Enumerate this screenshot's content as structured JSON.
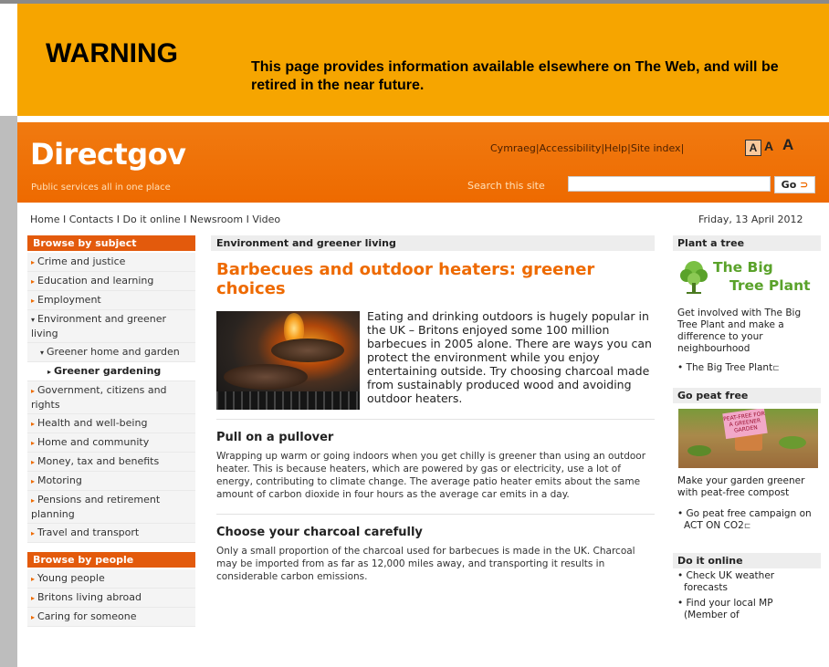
{
  "warning": {
    "title": "WARNING",
    "text": "This page provides information available elsewhere on The Web, and will be retired in the near future."
  },
  "header": {
    "logo": "Directgov",
    "tagline": "Public services all in one place",
    "util_links": [
      "Cymraeg",
      "Accessibility",
      "Help",
      "Site index"
    ],
    "text_size": [
      "A",
      "A",
      "A"
    ],
    "search_label": "Search this site",
    "search_value": "",
    "go_label": "Go"
  },
  "nav": {
    "items": [
      "Home",
      "Contacts",
      "Do it online",
      "Newsroom",
      "Video"
    ],
    "date": "Friday, 13 April 2012"
  },
  "left": {
    "subject_heading": "Browse by subject",
    "subject_items": [
      "Crime and justice",
      "Education and learning",
      "Employment",
      "Environment and greener living",
      "Greener home and garden",
      "Greener gardening",
      "Government, citizens and rights",
      "Health and well-being",
      "Home and community",
      "Money, tax and benefits",
      "Motoring",
      "Pensions and retirement planning",
      "Travel and transport"
    ],
    "people_heading": "Browse by people",
    "people_items": [
      "Young people",
      "Britons living abroad",
      "Caring for someone"
    ]
  },
  "main": {
    "section": "Environment and greener living",
    "title": "Barbecues and outdoor heaters: greener choices",
    "intro": "Eating and drinking outdoors is hugely popular in the UK – Britons enjoyed some 100 million barbecues in 2005 alone. There are ways you can protect the environment while you enjoy entertaining outside. Try choosing charcoal made from sustainably produced wood and avoiding outdoor heaters.",
    "sections": [
      {
        "heading": "Pull on a pullover",
        "text": "Wrapping up warm or going indoors when you get chilly is greener than using an outdoor heater. This is because heaters, which are powered by gas or electricity, use a lot of energy, contributing to climate change. The average patio heater emits about the same amount of carbon dioxide in four hours as the average car emits in a day."
      },
      {
        "heading": "Choose your charcoal carefully",
        "text": "Only a small proportion of the charcoal used for barbecues is made in the UK. Charcoal may be imported from as far as 12,000 miles away, and transporting it results in considerable carbon emissions."
      }
    ]
  },
  "right": {
    "tree_heading": "Plant a tree",
    "tree_logo_line1": "The Big",
    "tree_logo_line2": "Tree Plant",
    "tree_text": "Get involved with The Big Tree Plant and make a difference to your neighbourhood",
    "tree_link": "The Big Tree Plant",
    "peat_heading": "Go peat free",
    "peat_sign": "PEAT-FREE FOR A GREENER GARDEN",
    "peat_text": "Make your garden greener with peat-free compost",
    "peat_link": "Go peat free campaign on ACT ON CO2",
    "online_heading": "Do it online",
    "online_items": [
      "Check UK weather forecasts",
      "Find your local MP (Member of"
    ]
  },
  "colors": {
    "warning_bg": "#f6a500",
    "brand_orange": "#ee6a00",
    "nav_header_bg": "#e35a0c",
    "tree_green": "#5aa22a"
  }
}
